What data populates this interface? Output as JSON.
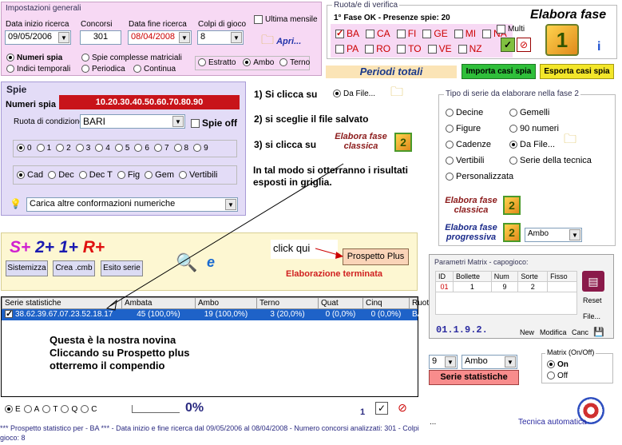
{
  "impostazioni": {
    "legend": "Impostazioni generali",
    "data_inizio_label": "Data inizio ricerca",
    "data_inizio": "09/05/2006",
    "concorsi_label": "Concorsi",
    "concorsi": "301",
    "data_fine_label": "Data fine ricerca",
    "data_fine": "08/04/2008",
    "colpi_label": "Colpi di gioco",
    "colpi": "8",
    "ultima_mensile": "Ultima mensile",
    "apri": "Apri...",
    "numeri_spia": "Numeri spia",
    "indici_temporali": "Indici temporali",
    "spie_complesse": "Spie complesse matriciali",
    "periodica": "Periodica",
    "continua": "Continua",
    "estratto": "Estratto",
    "ambo": "Ambo",
    "terno": "Terno"
  },
  "ruote": {
    "legend": "Ruota/e di verifica",
    "status": "1° Fase OK - Presenze spie: 20",
    "row1": [
      "BA",
      "CA",
      "FI",
      "GE",
      "MI",
      "NA"
    ],
    "row2": [
      "PA",
      "RO",
      "TO",
      "VE",
      "NZ"
    ],
    "multi": "Multi"
  },
  "elabora": {
    "title": "Elabora fase",
    "digit": "1"
  },
  "periodi_totali": "Periodi totali",
  "importa": "Importa casi spia",
  "esporta": "Esporta casi spia",
  "spie": {
    "title": "Spie",
    "numeri_spia_label": "Numeri spia",
    "numeri_spia_value": "10.20.30.40.50.60.70.80.90",
    "ruota_label": "Ruota di condizione",
    "ruota_value": "BARI",
    "spie_off": "Spie off",
    "digits": [
      "0",
      "1",
      "2",
      "3",
      "4",
      "5",
      "6",
      "7",
      "8",
      "9"
    ],
    "types": [
      "Cad",
      "Dec",
      "Dec T",
      "Fig",
      "Gem",
      "Vertibili"
    ],
    "carica": "Carica altre conformazioni numeriche"
  },
  "instructions": {
    "step1": "1) Si clicca su",
    "da_file": "Da File...",
    "step2": "2) si sceglie il file salvato",
    "step3": "3) si clicca su",
    "elabora_classica": "Elabora fase classica",
    "note": "In tal modo si otterranno i risultati esposti in griglia."
  },
  "tipo_serie": {
    "legend": "Tipo di serie da elaborare nella fase 2",
    "col1": [
      "Decine",
      "Figure",
      "Cadenze",
      "Vertibili",
      "Personalizzata"
    ],
    "col2": [
      "Gemelli",
      "90 numeri",
      "Da File...",
      "Serie della tecnica"
    ],
    "elabora_classica": "Elabora fase classica",
    "elabora_progressiva": "Elabora fase progressiva",
    "progressiva_select": "Ambo",
    "digit2": "2"
  },
  "sr": {
    "s": "S+",
    "two": "2+",
    "one": "1+",
    "r": "R+",
    "sistemizza": "Sistemizza",
    "crea_cmb": "Crea .cmb",
    "esito_serie": "Esito serie",
    "click_qui": "click qui",
    "prospetto_plus": "Prospetto Plus",
    "elaborazione": "Elaborazione terminata"
  },
  "grid": {
    "headers": [
      "Serie statistiche",
      "Ambata",
      "Ambo",
      "Terno",
      "Quat",
      "Cinq",
      "Ruota"
    ],
    "rows": [
      [
        "38.62.39.67.07.23.52.18.17",
        "45 (100,0%)",
        "19 (100,0%)",
        "3 (20,0%)",
        "0 (0,0%)",
        "0 (0,0%)",
        "BA"
      ]
    ]
  },
  "annotation": "Questa è la nostra novina Cliccando su Prospetto plus otterremo il compendio",
  "matrix": {
    "legend": "Parametri Matrix - capogioco:",
    "headers": [
      "ID",
      "Bollette",
      "Num",
      "Sorte",
      "Fisso"
    ],
    "row": [
      "01",
      "1",
      "9",
      "2",
      ""
    ],
    "code": "01.1.9.2.",
    "reset": "Reset",
    "file": "File...",
    "new": "New",
    "modifica": "Modifica",
    "canc": "Canc"
  },
  "bottom_right": {
    "num_select": "9",
    "sorte_select": "Ambo",
    "serie_statistiche": "Serie statistiche",
    "matrix_legend": "Matrix (On/Off)",
    "on": "On",
    "off": "Off",
    "tecnica": "Tecnica automatica",
    "ellipsis": "..."
  },
  "footer": {
    "radios": [
      "E",
      "A",
      "T",
      "Q",
      "C"
    ],
    "percent": "0%",
    "page": "1",
    "status": "*** Prospetto statistico per  - BA ***  - Data inizio e fine ricerca dal 09/05/2006 al 08/04/2008 - Numero concorsi analizzati: 301 - Colpi gioco: 8"
  }
}
